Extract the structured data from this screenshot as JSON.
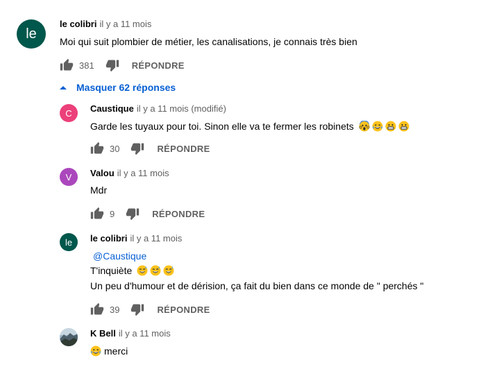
{
  "top_comment": {
    "avatar_letter": "le",
    "author": "le colibri",
    "time": "il y a 11 mois",
    "text": "Moi qui suit plombier de métier,  les canalisations,  je connais très bien",
    "likes": "381",
    "reply_label": "RÉPONDRE",
    "hide_replies": "Masquer 62 réponses"
  },
  "replies": [
    {
      "avatar_letter": "C",
      "avatar_color": "#ec407a",
      "author": "Caustique",
      "time": "il y a 11 mois (modifié)",
      "text": "Garde les tuyaux pour toi. Sinon elle va te fermer les robinets",
      "emojis": [
        "scream-emoji",
        "laugh-cry-emoji",
        "grin-emoji",
        "grin-emoji"
      ],
      "likes": "30",
      "reply_label": "RÉPONDRE"
    },
    {
      "avatar_letter": "V",
      "avatar_color": "#ab47bc",
      "author": "Valou",
      "time": "il y a 11 mois",
      "text": "Mdr",
      "likes": "9",
      "reply_label": "RÉPONDRE"
    },
    {
      "avatar_letter": "le",
      "avatar_color": "#00574b",
      "author": "le colibri",
      "time": "il y a 11 mois",
      "mention": "@Caustique",
      "line1": "T'inquiète",
      "line1_emojis": [
        "sweat-smile-emoji",
        "sweat-smile-emoji",
        "sweat-smile-emoji"
      ],
      "line2": "Un peu d'humour et de dérision,  ça  fait du bien dans ce monde de \" perchés \"",
      "likes": "39",
      "reply_label": "RÉPONDRE"
    },
    {
      "avatar_image": "mountain-photo",
      "author": "K Bell",
      "time": "il y a 11 mois",
      "text": "merci",
      "text_emoji": "laugh-cry-emoji"
    }
  ],
  "colors": {
    "accent": "#065fd4",
    "top_avatar": "#00574b"
  }
}
